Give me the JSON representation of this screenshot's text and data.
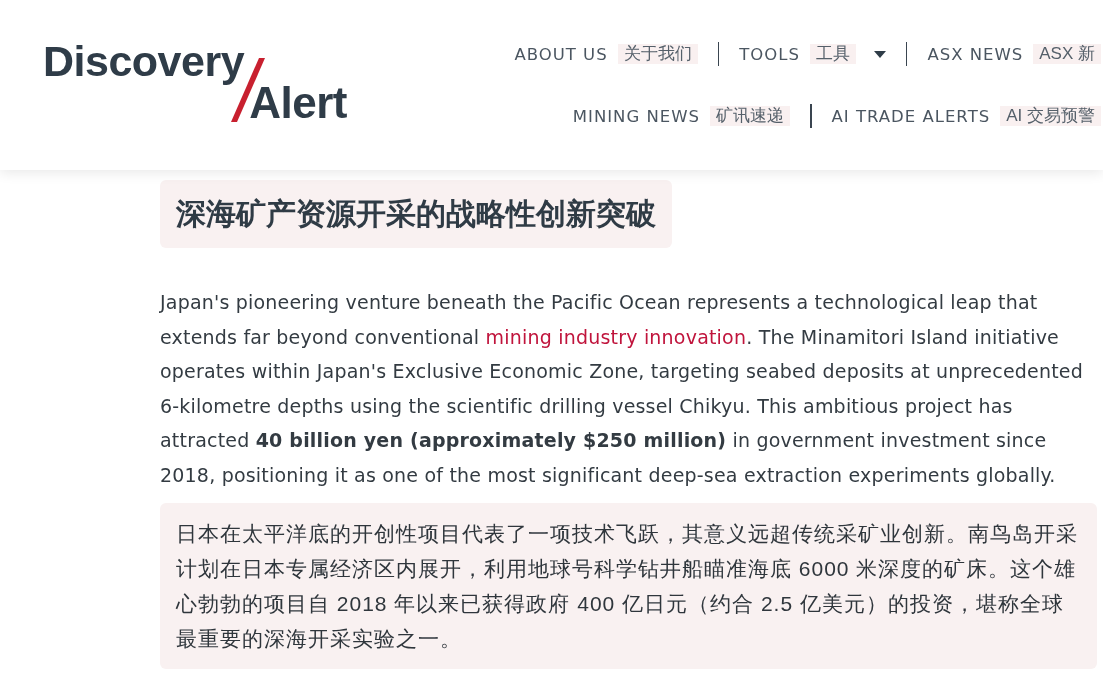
{
  "header": {
    "logo": {
      "line_1": "Discovery",
      "line_2": "Alert"
    },
    "nav_rows": [
      {
        "items": [
          {
            "label": "ABOUT US",
            "label_zh": "关于我们",
            "dropdown": false
          },
          {
            "label": "TOOLS",
            "label_zh": "工具",
            "dropdown": true
          },
          {
            "label": "ASX NEWS",
            "label_zh": "ASX 新",
            "dropdown": false
          }
        ]
      },
      {
        "items": [
          {
            "label": "MINING NEWS",
            "label_zh": "矿讯速递",
            "dropdown": false
          },
          {
            "label": "AI TRADE ALERTS",
            "label_zh": "AI 交易预警",
            "dropdown": false
          }
        ]
      }
    ]
  },
  "article": {
    "heading": "深海矿产资源开采的战略性创新突破",
    "paragraph": [
      {
        "kind": "text",
        "text": "Japan's pioneering venture beneath the Pacific Ocean represents a technological leap that extends far beyond conventional "
      },
      {
        "kind": "link",
        "text": "mining industry innovation"
      },
      {
        "kind": "text",
        "text": ". The Minamitori Island initiative operates within Japan's Exclusive Economic Zone, targeting seabed deposits at unprecedented 6-kilometre depths using the scientific drilling vessel Chikyu. This ambitious project has attracted **40 billion yen (approximately $250 million)** in government investment since 2018, positioning it as one of the most significant deep-sea extraction experiments globally."
      }
    ],
    "translation": "日本在太平洋底的开创性项目代表了一项技术飞跃，其意义远超传统采矿业创新。南鸟岛开采计划在日本专属经济区内展开，利用地球号科学钻井船瞄准海底 6000 米深度的矿床。这个雄心勃勃的项目自 2018 年以来已获得政府 400 亿日元（约合 2.5 亿美元）的投资，堪称全球最重要的深海开采实验之一。"
  }
}
